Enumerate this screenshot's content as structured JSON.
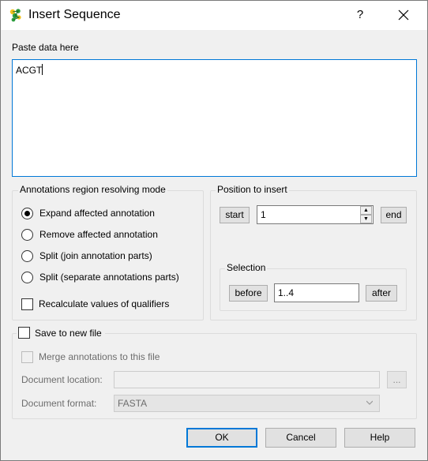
{
  "window": {
    "title": "Insert Sequence",
    "help_label": "?"
  },
  "paste": {
    "label": "Paste data here",
    "value": "ACGT"
  },
  "annotations": {
    "title": "Annotations region resolving mode",
    "options": [
      {
        "label": "Expand affected annotation",
        "checked": true
      },
      {
        "label": "Remove affected annotation",
        "checked": false
      },
      {
        "label": "Split (join annotation parts)",
        "checked": false
      },
      {
        "label": "Split (separate annotations parts)",
        "checked": false
      }
    ],
    "recalculate_label": "Recalculate values of qualifiers"
  },
  "position": {
    "title": "Position to insert",
    "start_label": "start",
    "value": "1",
    "end_label": "end",
    "selection": {
      "title": "Selection",
      "before_label": "before",
      "value": "1..4",
      "after_label": "after"
    }
  },
  "save": {
    "label": "Save to new file",
    "merge_label": "Merge annotations to this file",
    "location_label": "Document location:",
    "location_value": "",
    "browse_label": "...",
    "format_label": "Document format:",
    "format_value": "FASTA"
  },
  "buttons": {
    "ok": "OK",
    "cancel": "Cancel",
    "help": "Help"
  },
  "colors": {
    "focus_accent": "#0078d7",
    "dialog_bg": "#f0f0f0"
  }
}
